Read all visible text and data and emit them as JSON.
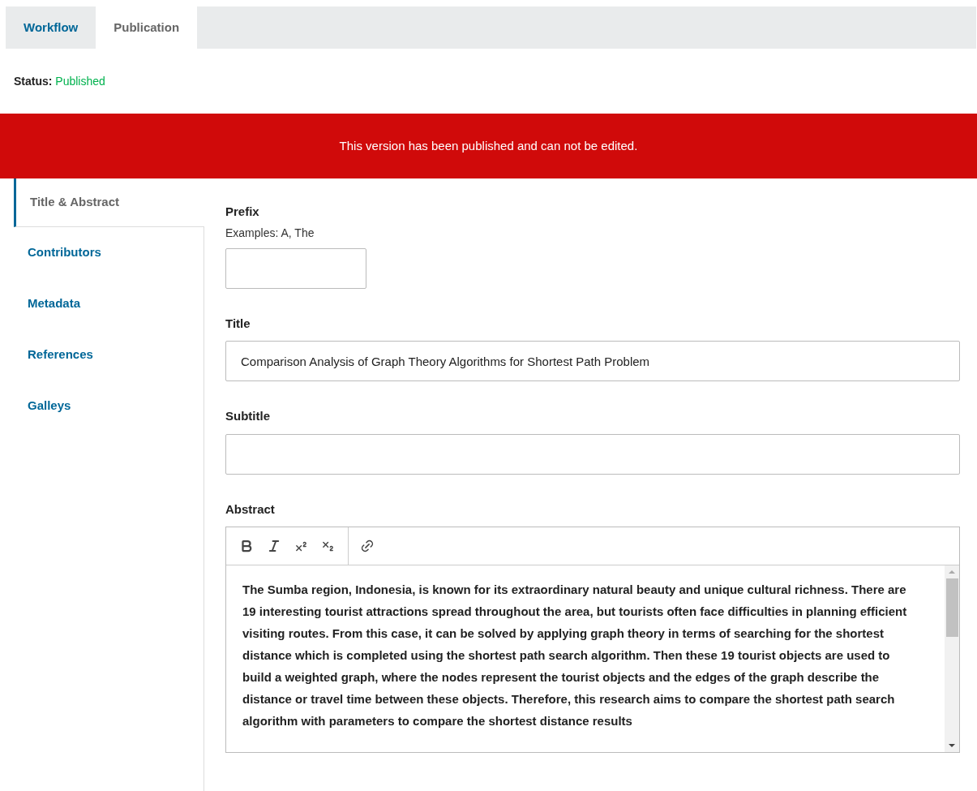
{
  "tabs": [
    {
      "label": "Workflow",
      "selected": false
    },
    {
      "label": "Publication",
      "selected": true
    }
  ],
  "status": {
    "label": "Status:",
    "value": "Published"
  },
  "banner": "This version has been published and can not be edited.",
  "sidebar": {
    "items": [
      {
        "label": "Title & Abstract",
        "selected": true
      },
      {
        "label": "Contributors",
        "selected": false
      },
      {
        "label": "Metadata",
        "selected": false
      },
      {
        "label": "References",
        "selected": false
      },
      {
        "label": "Galleys",
        "selected": false
      }
    ]
  },
  "form": {
    "prefix": {
      "label": "Prefix",
      "description": "Examples: A, The"
    },
    "title": {
      "label": "Title",
      "value": "Comparison Analysis of Graph Theory Algorithms for Shortest Path Problem"
    },
    "subtitle": {
      "label": "Subtitle"
    },
    "abstract": {
      "label": "Abstract",
      "value": "The Sumba region, Indonesia, is known for its extraordinary natural beauty and unique cultural richness. There are 19 interesting tourist attractions spread throughout the area, but tourists often face difficulties in planning efficient visiting routes. From this case, it can be solved by applying graph theory in terms of searching for the shortest distance which is completed using the shortest path search algorithm. Then these 19 tourist objects are used to build a weighted graph, where the nodes represent the tourist objects and the edges of the graph describe the distance or travel time between these objects. Therefore, this research aims to compare the shortest path search algorithm with parameters to compare the shortest distance results"
    }
  }
}
